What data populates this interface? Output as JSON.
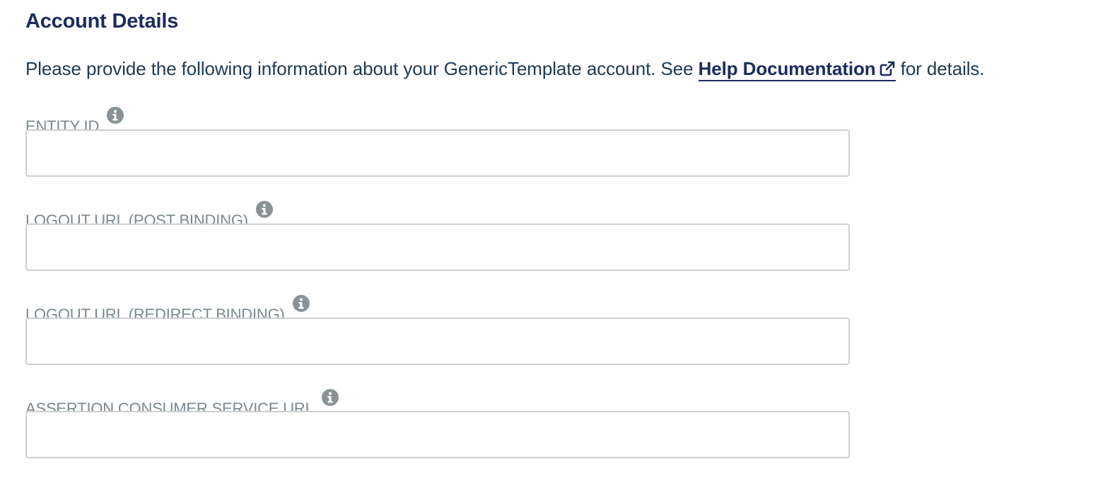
{
  "section": {
    "title": "Account Details"
  },
  "intro": {
    "text_before": "Please provide the following information about your GenericTemplate account. See ",
    "link_label": "Help Documentation",
    "text_after": " for details."
  },
  "fields": [
    {
      "label": "ENTITY ID",
      "value": "",
      "placeholder": ""
    },
    {
      "label": "LOGOUT URL (POST BINDING)",
      "value": "",
      "placeholder": ""
    },
    {
      "label": "LOGOUT URL (REDIRECT BINDING)",
      "value": "",
      "placeholder": ""
    },
    {
      "label": "ASSERTION CONSUMER SERVICE URL",
      "value": "",
      "placeholder": ""
    }
  ],
  "icons": {
    "info": "info-circle-icon",
    "external": "external-link-icon"
  },
  "colors": {
    "title": "#1b2c5e",
    "link": "#1b2c5e",
    "label": "#7c898f",
    "info_icon": "#8a9296",
    "input_border": "#cfcfcf"
  }
}
